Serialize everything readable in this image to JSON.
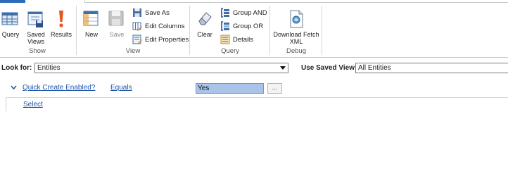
{
  "ribbon": {
    "show_group": {
      "label": "Show",
      "query": "Query",
      "saved_views": "Saved Views",
      "results": "Results"
    },
    "view_group": {
      "label": "View",
      "new": "New",
      "save": "Save",
      "save_as": "Save As",
      "edit_columns": "Edit Columns",
      "edit_properties": "Edit Properties"
    },
    "query_group": {
      "label": "Query",
      "clear": "Clear",
      "group_and": "Group AND",
      "group_or": "Group OR",
      "details": "Details"
    },
    "debug_group": {
      "label": "Debug",
      "download_fetch_xml": "Download Fetch XML"
    }
  },
  "query": {
    "look_for_label": "Look for:",
    "look_for_value": "Entities",
    "saved_view_label": "Use Saved View:",
    "saved_view_value": "All Entities",
    "condition": {
      "field": "Quick Create Enabled?",
      "operator": "Equals",
      "value": "Yes",
      "ellipsis": "..."
    },
    "select_link": "Select"
  },
  "colors": {
    "accent": "#2a6ebb",
    "link": "#1a52a8",
    "selected_value_bg": "#a9c4e8"
  }
}
